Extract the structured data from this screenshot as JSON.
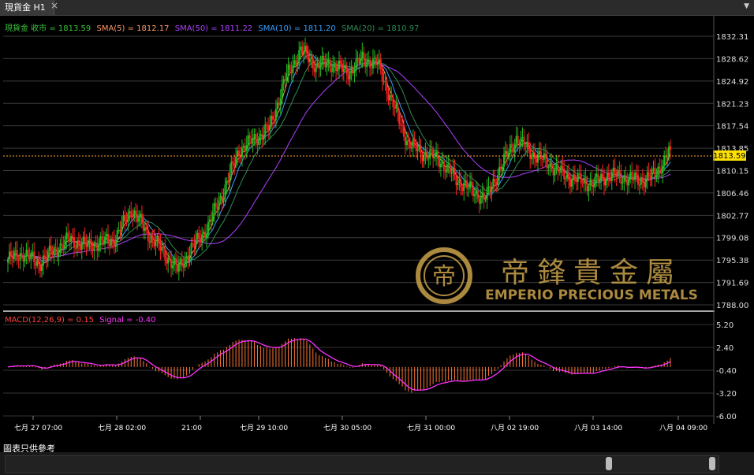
{
  "tab": {
    "title": "現貨金 H1",
    "close": "×"
  },
  "legend_main": [
    {
      "text": "現貨金 收市 = 1813.59",
      "color": "#3ac43a"
    },
    {
      "text": "SMA(5) = 1812.17",
      "color": "#ff9966"
    },
    {
      "text": "SMA(50) = 1811.22",
      "color": "#b040ff"
    },
    {
      "text": "SMA(10) = 1811.20",
      "color": "#3aa0ff"
    },
    {
      "text": "SMA(20) = 1810.97",
      "color": "#2e8b57"
    }
  ],
  "legend_macd": [
    {
      "text": "MACD(12,26,9) = 0.15",
      "color": "#ff4040"
    },
    {
      "text": "Signal = -0.40",
      "color": "#ff33ff"
    }
  ],
  "hint": "圖表只供參考",
  "watermark": {
    "name": "EMPERIO PRECIOUS METALS",
    "chinese": "帝鋒貴金屬"
  },
  "current_price": "1813.59",
  "chart_data": [
    {
      "type": "candlestick",
      "y_ticks": [
        "1832.31",
        "1828.62",
        "1824.92",
        "1821.23",
        "1817.54",
        "1813.85",
        "1810.15",
        "1806.46",
        "1802.77",
        "1799.08",
        "1795.38",
        "1791.69",
        "1788.00"
      ],
      "ylim": [
        1788.0,
        1832.31
      ],
      "x_ticks": [
        "七月 27 07:00",
        "七月 28 02:00",
        "21:00",
        "七月 29 10:00",
        "七月 30 05:00",
        "七月 31 00:00",
        "八月 02 19:00",
        "八月 03 14:00",
        "八月 04 09:00"
      ],
      "close_anchors": [
        [
          0,
          1795.5
        ],
        [
          10,
          1796.5
        ],
        [
          20,
          1794.8
        ],
        [
          30,
          1797.0
        ],
        [
          40,
          1798.8
        ],
        [
          50,
          1797.8
        ],
        [
          60,
          1798.2
        ],
        [
          70,
          1799.0
        ],
        [
          80,
          1803.8
        ],
        [
          90,
          1800.0
        ],
        [
          100,
          1797.0
        ],
        [
          110,
          1793.8
        ],
        [
          120,
          1797.5
        ],
        [
          130,
          1801.0
        ],
        [
          140,
          1806.8
        ],
        [
          150,
          1813.5
        ],
        [
          160,
          1815.3
        ],
        [
          170,
          1817.2
        ],
        [
          180,
          1825.3
        ],
        [
          190,
          1830.0
        ],
        [
          200,
          1827.5
        ],
        [
          210,
          1827.8
        ],
        [
          220,
          1826.3
        ],
        [
          230,
          1828.5
        ],
        [
          240,
          1827.8
        ],
        [
          250,
          1821.0
        ],
        [
          260,
          1814.5
        ],
        [
          270,
          1813.0
        ],
        [
          280,
          1812.0
        ],
        [
          290,
          1809.0
        ],
        [
          300,
          1807.0
        ],
        [
          310,
          1805.5
        ],
        [
          320,
          1810.8
        ],
        [
          330,
          1815.5
        ],
        [
          340,
          1813.0
        ],
        [
          350,
          1811.5
        ],
        [
          360,
          1809.5
        ],
        [
          370,
          1808.5
        ],
        [
          380,
          1808.0
        ],
        [
          390,
          1809.5
        ],
        [
          400,
          1809.0
        ],
        [
          410,
          1808.5
        ],
        [
          420,
          1809.5
        ],
        [
          430,
          1813.6
        ]
      ],
      "series": [
        {
          "name": "SMA(5)"
        },
        {
          "name": "SMA(50)"
        },
        {
          "name": "SMA(10)"
        },
        {
          "name": "SMA(20)"
        }
      ]
    },
    {
      "type": "bar",
      "y_ticks": [
        "5.20",
        "2.40",
        "-0.40",
        "-3.20",
        "-6.00"
      ],
      "ylim": [
        -6.0,
        5.2
      ],
      "series": [
        {
          "name": "MACD(12,26,9)"
        },
        {
          "name": "Signal"
        }
      ]
    }
  ]
}
